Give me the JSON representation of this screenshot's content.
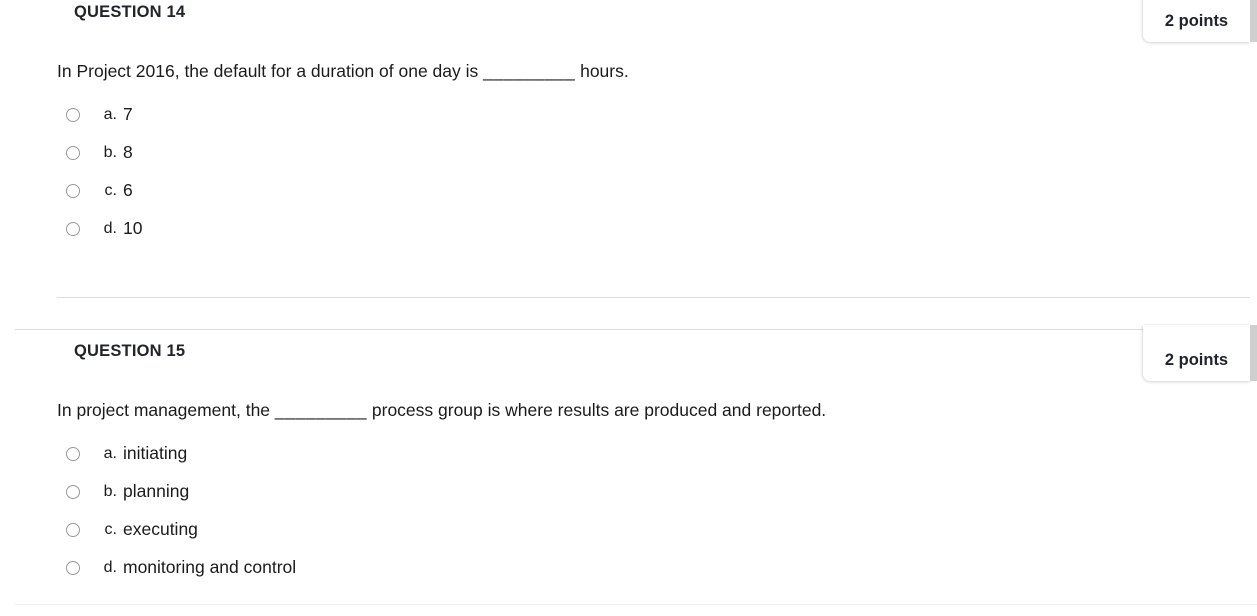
{
  "page": {
    "background_color": "#ffffff",
    "text_color": "#1b1b1b",
    "divider_color": "#dedede"
  },
  "questions": [
    {
      "heading": "QUESTION 14",
      "points_label": "2 points",
      "prompt_before": "In Project 2016, the default for a duration of one day is ",
      "prompt_blank": "_________",
      "prompt_after": " hours.",
      "options": [
        {
          "letter": "a.",
          "text": "7",
          "selected": false
        },
        {
          "letter": "b.",
          "text": "8",
          "selected": false
        },
        {
          "letter": "c.",
          "text": "6",
          "selected": false
        },
        {
          "letter": "d.",
          "text": "10",
          "selected": false
        }
      ]
    },
    {
      "heading": "QUESTION 15",
      "points_label": "2 points",
      "prompt_before": "In project management, the ",
      "prompt_blank": "_________",
      "prompt_after": " process group is where results are produced and reported.",
      "options": [
        {
          "letter": "a.",
          "text": "initiating",
          "selected": false
        },
        {
          "letter": "b.",
          "text": "planning",
          "selected": false
        },
        {
          "letter": "c.",
          "text": "executing",
          "selected": false
        },
        {
          "letter": "d.",
          "text": "monitoring and control",
          "selected": false
        }
      ]
    }
  ]
}
